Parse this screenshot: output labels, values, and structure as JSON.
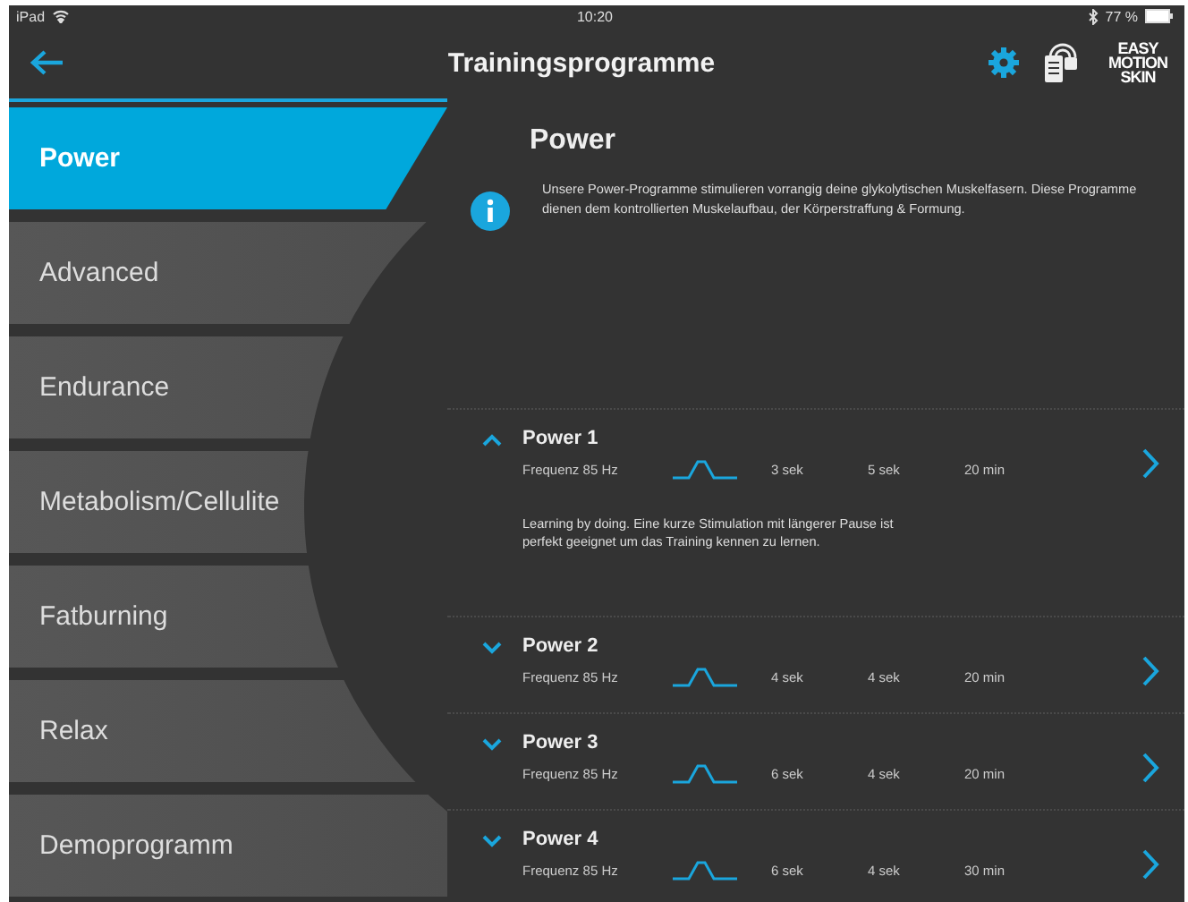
{
  "status_bar": {
    "device": "iPad",
    "time": "10:20",
    "battery": "77 %"
  },
  "header": {
    "title": "Trainingsprogramme",
    "logo": [
      "EASY",
      "MOTION",
      "SKIN"
    ]
  },
  "sidebar": {
    "items": [
      {
        "label": "Power",
        "selected": true
      },
      {
        "label": "Advanced",
        "selected": false
      },
      {
        "label": "Endurance",
        "selected": false
      },
      {
        "label": "Metabolism/Cellulite",
        "selected": false
      },
      {
        "label": "Fatburning",
        "selected": false
      },
      {
        "label": "Relax",
        "selected": false
      },
      {
        "label": "Demoprogramm",
        "selected": false
      }
    ]
  },
  "content": {
    "title": "Power",
    "description": "Unsere Power-Programme stimulieren vorrangig deine glykolytischen Muskelfasern. Diese Programme dienen dem kontrollierten Muskelaufbau, der Körperstraffung & Formung.",
    "programs": [
      {
        "name": "Power 1",
        "expanded": true,
        "frequency": "Frequenz 85 Hz",
        "time_1": "3 sek",
        "time_2": "5 sek",
        "duration": "20 min",
        "details": "Learning by doing. Eine kurze Stimulation mit längerer Pause ist perfekt geeignet um das Training kennen zu lernen."
      },
      {
        "name": "Power 2",
        "expanded": false,
        "frequency": "Frequenz 85 Hz",
        "time_1": "4 sek",
        "time_2": "4 sek",
        "duration": "20 min"
      },
      {
        "name": "Power 3",
        "expanded": false,
        "frequency": "Frequenz 85 Hz",
        "time_1": "6 sek",
        "time_2": "4 sek",
        "duration": "20 min"
      },
      {
        "name": "Power 4",
        "expanded": false,
        "frequency": "Frequenz 85 Hz",
        "time_1": "6 sek",
        "time_2": "4 sek",
        "duration": "30 min"
      }
    ]
  }
}
